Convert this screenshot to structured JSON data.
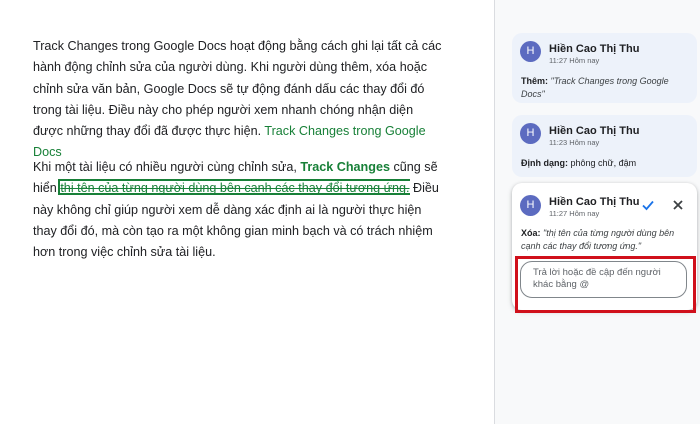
{
  "document": {
    "paragraph1": {
      "text": "Track Changes trong Google Docs hoạt động bằng cách ghi lại tất cả các hành động chỉnh sửa của người dùng. Khi người dùng thêm, xóa hoặc chỉnh sửa văn bản, Google Docs sẽ tự động đánh dấu các thay đổi đó trong tài liệu. Điều này cho phép người xem nhanh chóng nhận diện được những thay đổi đã được thực hiện.",
      "inserted": "Track Changes trong Google Docs"
    },
    "paragraph2": {
      "before": "Khi một tài liệu có nhiều người cùng chỉnh sửa, ",
      "bold_inserted": "Track Changes",
      "middle": " cũng sẽ hiển",
      "deleted": "thị tên của từng người dùng bên cạnh các thay đổi tương ứng.",
      "after": " Điều này không chỉ giúp người xem dễ dàng xác định ai là người thực hiện thay đổi đó, mà còn tạo ra một không gian minh bạch và có trách nhiệm hơn trong việc chỉnh sửa tài liệu."
    }
  },
  "comments": [
    {
      "avatar": "H",
      "name": "Hiền Cao Thị Thu",
      "time": "11:27 Hôm nay",
      "label": "Thêm:",
      "content": "\"Track Changes trong Google Docs\""
    },
    {
      "avatar": "H",
      "name": "Hiền Cao Thị Thu",
      "time": "11:23 Hôm nay",
      "label": "Định dạng:",
      "content": "phông chữ, đậm"
    },
    {
      "avatar": "H",
      "name": "Hiền Cao Thị Thu",
      "time": "11:27 Hôm nay",
      "label": "Xóa:",
      "content": "\"thị tên của từng người dùng bên cạnh các thay đổi tương ứng.\"",
      "reply_placeholder": "Trả lời hoặc đề cập đến người khác bằng @"
    }
  ],
  "icons": {
    "accept": "check-icon",
    "reject": "close-icon"
  },
  "colors": {
    "suggestion": "#188038",
    "avatar": "#5c6bc0",
    "highlight_box": "#d0101b",
    "accept_icon": "#1a73e8"
  }
}
